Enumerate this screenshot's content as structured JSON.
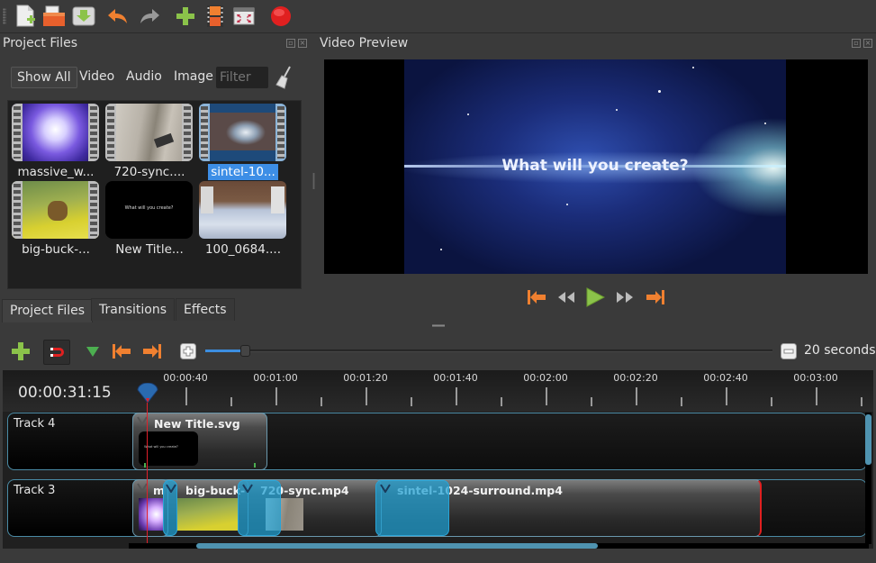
{
  "toolbar": {
    "buttons": [
      {
        "name": "new-project",
        "icon": "new-file-icon",
        "tooltip": "New Project"
      },
      {
        "name": "open-project",
        "icon": "open-folder-icon",
        "tooltip": "Open Project"
      },
      {
        "name": "save-project",
        "icon": "save-icon",
        "tooltip": "Save Project"
      },
      {
        "name": "undo",
        "icon": "undo-icon",
        "tooltip": "Undo"
      },
      {
        "name": "redo",
        "icon": "redo-icon",
        "tooltip": "Redo"
      },
      {
        "name": "import-files",
        "icon": "plus-icon",
        "tooltip": "Import Files"
      },
      {
        "name": "choose-profile",
        "icon": "film-icon",
        "tooltip": "Choose Profile"
      },
      {
        "name": "fullscreen",
        "icon": "fullscreen-icon",
        "tooltip": "Fullscreen"
      },
      {
        "name": "export-video",
        "icon": "record-icon",
        "tooltip": "Export Video"
      }
    ]
  },
  "project_files": {
    "title": "Project Files",
    "filters": [
      "Show All",
      "Video",
      "Audio",
      "Image"
    ],
    "active_filter": "Show All",
    "filter_placeholder": "Filter",
    "files": [
      {
        "label": "massive_w...",
        "type": "video",
        "selected": false
      },
      {
        "label": "720-sync....",
        "type": "video",
        "selected": false
      },
      {
        "label": "sintel-10...",
        "type": "video",
        "selected": true
      },
      {
        "label": "big-buck-...",
        "type": "video",
        "selected": false
      },
      {
        "label": "New Title...",
        "type": "title",
        "selected": false,
        "thumb_text": "What will you create?"
      },
      {
        "label": "100_0684....",
        "type": "image",
        "selected": false
      }
    ],
    "tabs": [
      "Project Files",
      "Transitions",
      "Effects"
    ],
    "active_tab": "Project Files"
  },
  "video_preview": {
    "title": "Video Preview",
    "frame_text": "What will you create?",
    "controls": [
      "jump-start",
      "rewind",
      "play",
      "fast-forward",
      "jump-end"
    ]
  },
  "timeline_toolbar": {
    "zoom_label": "20 seconds",
    "zoom_fraction": 0.07
  },
  "timeline": {
    "timecode": "00:00:31:15",
    "ruler_labels": [
      "00:00:40",
      "00:01:00",
      "00:01:20",
      "00:01:40",
      "00:02:00",
      "00:02:20",
      "00:02:40",
      "00:03:00"
    ],
    "tracks": [
      {
        "name": "Track 4",
        "clips": [
          {
            "title": "New Title.svg",
            "thumb_text": "What will you create?"
          }
        ]
      },
      {
        "name": "Track 3",
        "clips": [
          {
            "title": "m"
          },
          {
            "title": "big-buck-"
          },
          {
            "title": "720-sync.mp4"
          },
          {
            "title": "sintel-1024-surround.mp4"
          }
        ]
      }
    ]
  }
}
